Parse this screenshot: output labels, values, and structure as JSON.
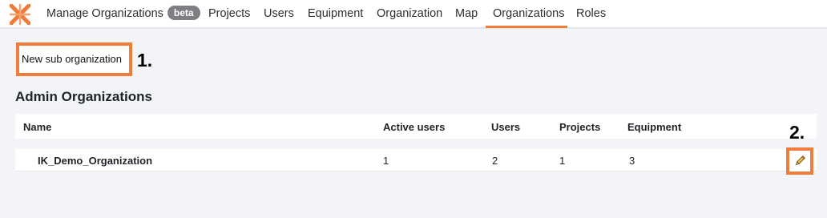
{
  "nav": {
    "items": [
      {
        "label": "Manage Organizations",
        "badge": "beta"
      },
      {
        "label": "Projects"
      },
      {
        "label": "Users"
      },
      {
        "label": "Equipment"
      },
      {
        "label": "Organization"
      },
      {
        "label": "Map"
      },
      {
        "label": "Organizations"
      },
      {
        "label": "Roles"
      }
    ],
    "active": "Organizations"
  },
  "actions": {
    "new_sub_org_label": "New sub organization"
  },
  "annotations": {
    "step1": "1.",
    "step2": "2."
  },
  "section": {
    "title": "Admin Organizations"
  },
  "table": {
    "columns": [
      "Name",
      "Active users",
      "Users",
      "Projects",
      "Equipment"
    ],
    "rows": [
      {
        "name": "IK_Demo_Organization",
        "active_users": "1",
        "users": "2",
        "projects": "1",
        "equipment": "3"
      }
    ]
  },
  "colors": {
    "accent": "#f07c3a",
    "highlight_border": "#ef7d3b",
    "badge_bg": "#7d7f82",
    "page_bg": "#f2f4f7"
  }
}
